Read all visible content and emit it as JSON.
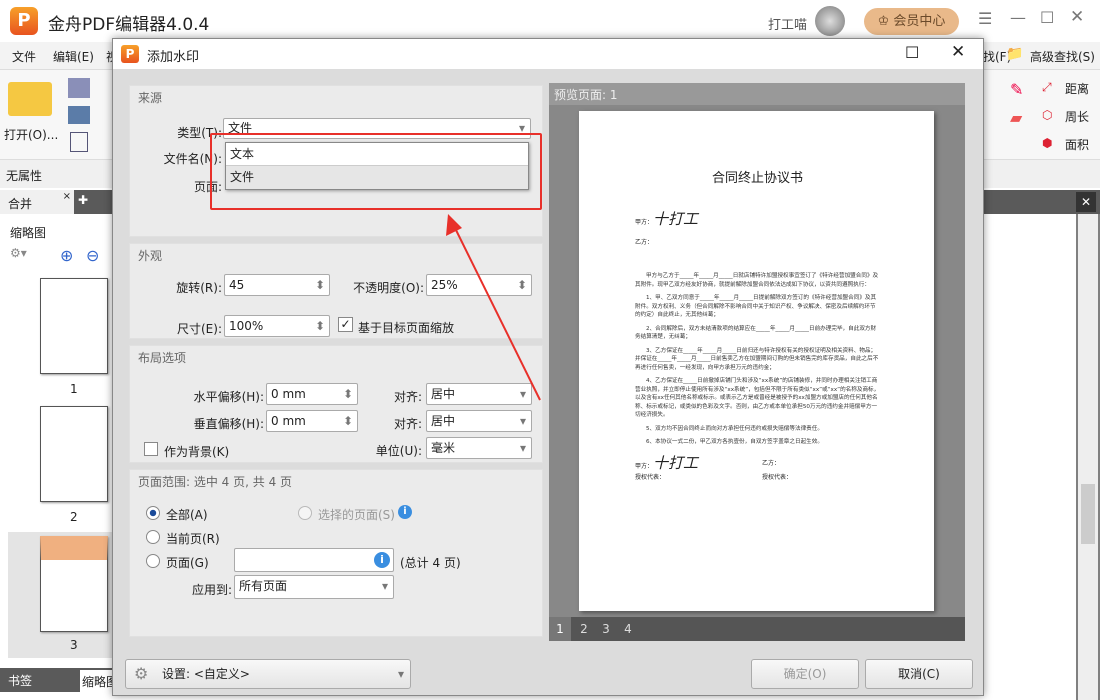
{
  "app": {
    "title": "金舟PDF编辑器4.0.4",
    "user": "打工喵",
    "vip_button": "会员中心",
    "colors": {
      "accent": "#e8531f",
      "vip": "#e9b98a"
    }
  },
  "menu": {
    "items": [
      "文件",
      "编辑(E)",
      "视"
    ],
    "find": "找(F)",
    "advanced_find": "高级查找(S)"
  },
  "ribbon": {
    "open": "打开(O)...",
    "tools": [
      "距离",
      "周长",
      "面积"
    ]
  },
  "props": {
    "label": "无属性"
  },
  "left_panel": {
    "tab": "合并",
    "header": "缩略图",
    "pages": [
      "1",
      "2",
      "3"
    ],
    "bottom_tabs": [
      "书签",
      "缩略图"
    ]
  },
  "dialog": {
    "title": "添加水印",
    "source": {
      "header": "来源",
      "type_label": "类型(T):",
      "type_value": "文件",
      "filename_label": "文件名(N):",
      "page_label": "页面:",
      "options": [
        "文本",
        "文件"
      ],
      "highlighted": "文件"
    },
    "appearance": {
      "header": "外观",
      "rotate_label": "旋转(R):",
      "rotate_value": "45",
      "opacity_label": "不透明度(O):",
      "opacity_value": "25%",
      "size_label": "尺寸(E):",
      "size_value": "100%",
      "scale_label": "基于目标页面缩放",
      "scale_checked": true
    },
    "layout": {
      "header": "布局选项",
      "hoffset_label": "水平偏移(H):",
      "hoffset_value": "0 mm",
      "voffset_label": "垂直偏移(H):",
      "voffset_value": "0 mm",
      "align_label": "对齐:",
      "halign": "居中",
      "valign": "居中",
      "unit_label": "单位(U):",
      "unit_value": "毫米",
      "background_label": "作为背景(K)",
      "background_checked": false
    },
    "range": {
      "header": "页面范围: 选中 4 页, 共 4 页",
      "all": "全部(A)",
      "selected": "选择的页面(S)",
      "current": "当前页(R)",
      "pages": "页面(G)",
      "pages_value": "",
      "total": "(总计 4 页)",
      "apply_label": "应用到:",
      "apply_value": "所有页面",
      "checked": "all"
    },
    "preview": {
      "header": "预览页面: 1",
      "page_tabs": [
        "1",
        "2",
        "3",
        "4"
      ],
      "active_page": "1"
    },
    "settings": {
      "label": "设置: <自定义>"
    },
    "ok": "确定(O)",
    "cancel": "取消(C)"
  },
  "document": {
    "title": "合同终止协议书",
    "party_a": "甲方：",
    "party_b": "乙方：",
    "paragraphs": [
      "甲方与乙方于_____年_____月_____日就店铺特许加盟授权事宜签订了《特许经营加盟合同》及其附件。现甲乙双方经友好协商，就提前解除加盟合同依法达成如下协议，以资共同遵照执行：",
      "1、甲、乙双方同意于_____年_____月_____日提前解除双方签订的《特许经营加盟合同》及其附件。双方权利、义务（但合同解除不影响合同中关于知识产权、争议解决、保密及后续解约环节的约定）自此终止，无其他纠葛；",
      "2、合同解除后，双方未结清款项的结算应在_____年_____月_____日前办理完毕，自此双方财务结算清楚，无纠葛；",
      "3、乙方保证在_____年_____月_____日前归还与特许授权有关的授权证明及相关资料、物品；并保证在_____年_____月_____日前售卖乙方在加盟期间订购的但未销售完的库存货品，自此之后不再进行任何售卖，一经发现，向甲方承担万元的违约金；",
      "4、乙方保证在_____日前撤掉店铺门头和涉及“xx系统”的店铺装修，并同时办理相关注销工商营业执照，并立即停止使用所有涉及“xx系统”，包括但不限于所有类似“xx”或“xx”的名称及商标，以及含有xx任何其他名称或标示。或表示乙方是或曾经是被授予的xx加盟方或加盟店的任何其他名称、标示或标记，或类似的色彩及文字。否则，由乙方或本单位承担50万元的违约金并赔偿甲方一切经济损失。",
      "5、双方均不因合同终止而向对方承担任何违约或损失赔偿等法律责任。",
      "6、本协议一式二份，甲乙双方各执壹份，自双方签字盖章之日起生效。"
    ],
    "sign_a": "甲方：",
    "sign_b": "乙方：",
    "rep_a": "授权代表：",
    "rep_b": "授权代表："
  }
}
